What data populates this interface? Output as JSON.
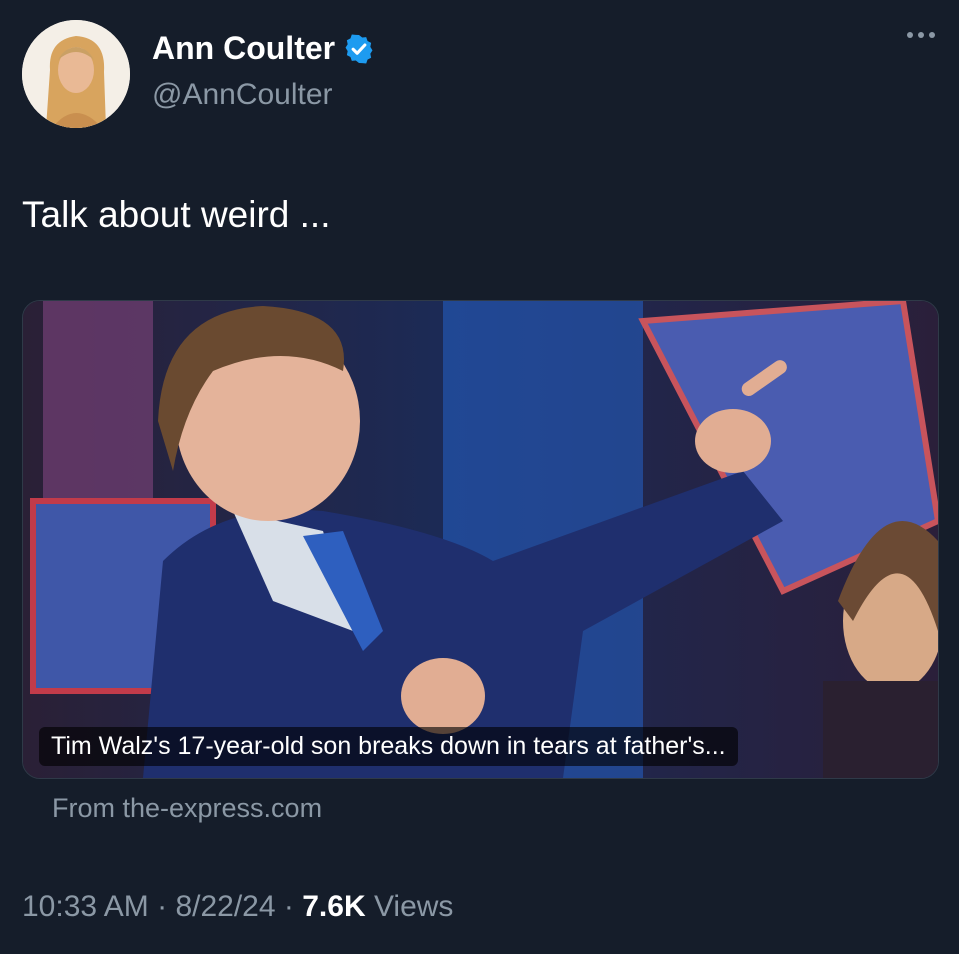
{
  "author": {
    "name": "Ann Coulter",
    "handle": "@AnnCoulter",
    "verified_icon": "verified-badge-icon",
    "verified_color": "#1d9bf0"
  },
  "more_icon": "more-options-icon",
  "tweet": {
    "text": "Talk about weird ..."
  },
  "link_card": {
    "headline": "Tim Walz's 17-year-old son breaks down in tears at father's...",
    "source": "From the-express.com"
  },
  "meta": {
    "time": "10:33 AM",
    "separator": "·",
    "date": "8/22/24",
    "views_count": "7.6K",
    "views_label": "Views"
  },
  "colors": {
    "background": "#151d2a",
    "primary_text": "#ffffff",
    "secondary_text": "#8b98a5",
    "accent": "#1d9bf0"
  }
}
